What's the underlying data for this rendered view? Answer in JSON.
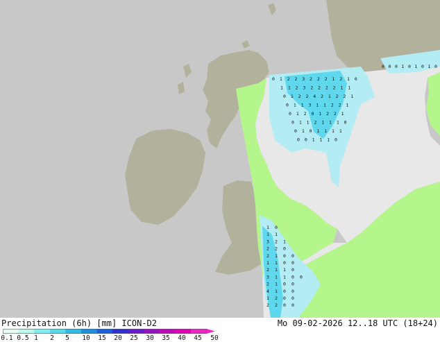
{
  "header": {
    "title": "Precipitation (6h) [mm] ICON-D2",
    "datetime": "Mo 09-02-2026 12..18 UTC (18+24)"
  },
  "legend": {
    "ticks": [
      "0.1",
      "0.5",
      "1",
      "2",
      "5",
      "10",
      "15",
      "20",
      "25",
      "30",
      "35",
      "40",
      "45",
      "50"
    ],
    "colors": [
      "#e6fff2",
      "#b9fbef",
      "#7eeff2",
      "#53dcee",
      "#2bbcea",
      "#1b91e6",
      "#1a5fe0",
      "#2f2fd6",
      "#6a1bd2",
      "#9a10c9",
      "#c707bf",
      "#e600b8",
      "#f224c8"
    ]
  },
  "colors": {
    "background_grey": "#c8c8c8",
    "land_outside_domain": "#b2b29c",
    "land_inside_domain": "#b4f58c",
    "sea_inside_domain": "#e8e8e8",
    "rain_light": "#b4ecf4",
    "rain_medium": "#5fd7ec"
  },
  "map": {
    "north_row_values": [
      "0 1 2 2 3 2 2 2 1 2 1 0",
      "1 1 2 3 2 2 2 2 1 1",
      "0 1 2 2 4 2 1 2 2 1",
      "0 1 1 3 1 1 2 2 1",
      "0 1 2 0 1 2 2 1",
      "0 1 1 2 1 1 1 0",
      "0 1 0 1 1 1 1",
      "0 0 1 1 1 0"
    ],
    "south_row_values": [
      "1 0",
      "1 1",
      "3 2 1",
      "2 2 0",
      "2 1 0 0",
      "1 1 0 0",
      "2 1 1 0",
      "3 1 1 0 0",
      "2 1 0 0",
      "4 1 0 0",
      "1 2 0 0",
      "2 2 0 0"
    ],
    "german_coast_values": "0 0 0 1 0 1 0 1 0 0"
  }
}
